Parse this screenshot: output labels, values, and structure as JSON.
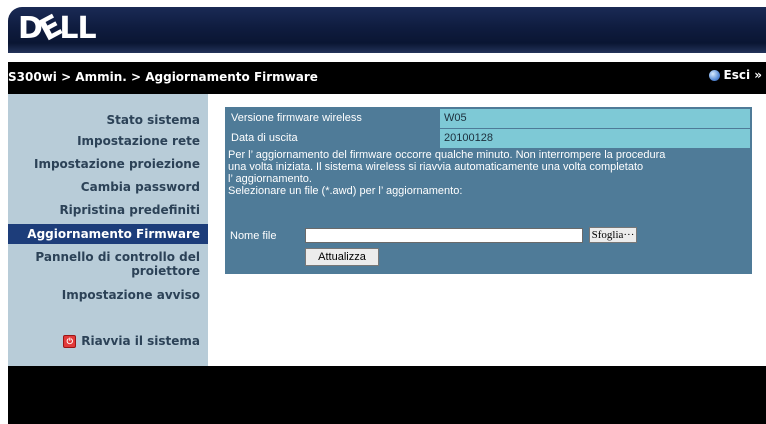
{
  "brand": {
    "logo_text_d": "D",
    "logo_text_e": "E",
    "logo_text_ll": "LL"
  },
  "breadcrumb": "S300wi > Ammin. > Aggiornamento Firmware",
  "exit_label": "Esci »",
  "sidebar": {
    "items": [
      {
        "label": "Stato sistema"
      },
      {
        "label": "Impostazione rete"
      },
      {
        "label": "Impostazione proiezione"
      },
      {
        "label": "Cambia password"
      },
      {
        "label": "Ripristina predefiniti"
      },
      {
        "label": "Aggiornamento Firmware"
      },
      {
        "label": "Pannello di controllo del proiettore"
      },
      {
        "label": "Impostazione avviso"
      }
    ],
    "active_index": 5,
    "reboot_label": "Riavvia il sistema"
  },
  "firmware": {
    "version_label": "Versione firmware wireless",
    "version_value": "W05",
    "date_label": "Data di uscita",
    "date_value": "20100128",
    "info_line1": "Per l’ aggiornamento del firmware occorre qualche minuto. Non interrompere la procedura",
    "info_line2": "una volta iniziata. Il sistema wireless si riavvia automaticamente una volta completato",
    "info_line3": "l’ aggiornamento.",
    "info_line4": "Selezionare un file (*.awd) per l’ aggiornamento:",
    "file_label": "Nome file",
    "file_value": "",
    "browse_label": "Sfoglia···",
    "update_label": "Attualizza"
  },
  "colors": {
    "sidebar_bg": "#b8ccd8",
    "active_bg": "#1d3d7a",
    "panel_bg": "#4f7b98",
    "value_bg": "#7ec9d6"
  }
}
